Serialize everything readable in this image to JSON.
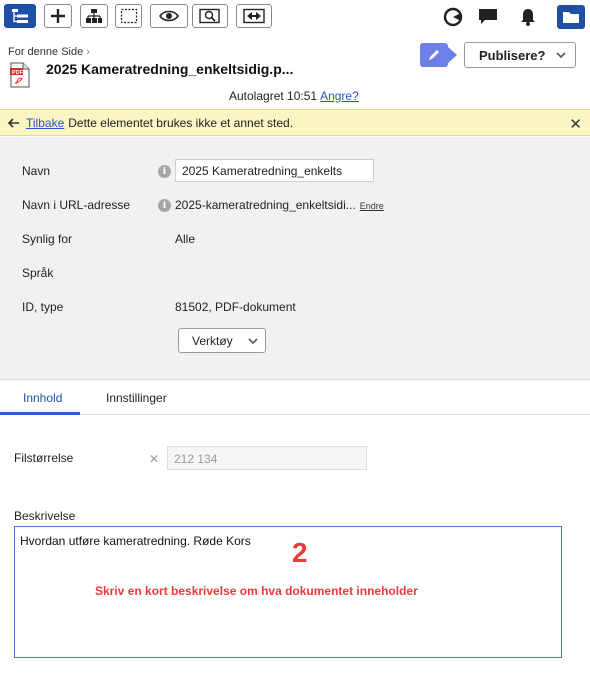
{
  "toolbar": {
    "left_buttons": [
      {
        "name": "structure-tree-button",
        "icon": "structure-tree-icon",
        "active": true
      },
      {
        "name": "add-button",
        "icon": "plus-icon"
      },
      {
        "name": "hierarchy-button",
        "icon": "hierarchy-icon"
      },
      {
        "name": "select-area-button",
        "icon": "dotted-select-icon"
      },
      {
        "name": "preview-button",
        "icon": "eye-icon"
      },
      {
        "name": "preview-zoom-button",
        "icon": "zoom-preview-icon"
      },
      {
        "name": "compare-button",
        "icon": "compare-arrows-icon"
      }
    ],
    "right_icons": [
      "status-icon",
      "comment-icon",
      "bell-icon",
      "folder-icon"
    ]
  },
  "header": {
    "breadcrumb": "For denne Side",
    "title": "2025 Kameratredning_enkeltsidig.p...",
    "publish_label": "Publisere?",
    "autosave_text": "Autolagret 10:51",
    "undo_link": "Angre?"
  },
  "notice": {
    "back_link": "Tilbake",
    "message": "Dette elementet brukes ikke et annet sted."
  },
  "properties": {
    "name_label": "Navn",
    "name_value": "2025 Kameratredning_enkelts",
    "url_label": "Navn i URL-adresse",
    "url_value": "2025-kameratredning_enkeltsidi...",
    "change_link": "Endre",
    "visible_label": "Synlig for",
    "visible_value": "Alle",
    "language_label": "Språk",
    "id_label": "ID, type",
    "id_value": "81502, PDF-dokument",
    "tools_label": "Verktøy"
  },
  "tabs": [
    {
      "label": "Innhold",
      "active": true
    },
    {
      "label": "Innstillinger",
      "active": false
    }
  ],
  "content": {
    "filesize_label": "Filstørrelse",
    "filesize_value": "212 134",
    "description_label": "Beskrivelse",
    "description_value": "Hvordan utføre kameratredning. Røde Kors",
    "annotation_number": "2",
    "annotation_text": "Skriv en kort beskrivelse om hva dokumentet inneholder"
  },
  "colors": {
    "accent": "#1f4fa6",
    "edit_button": "#6e7fe8",
    "notice_bg": "#fbf5c4",
    "annotation": "#ea3b3b",
    "pdf_red": "#d32f2f"
  }
}
